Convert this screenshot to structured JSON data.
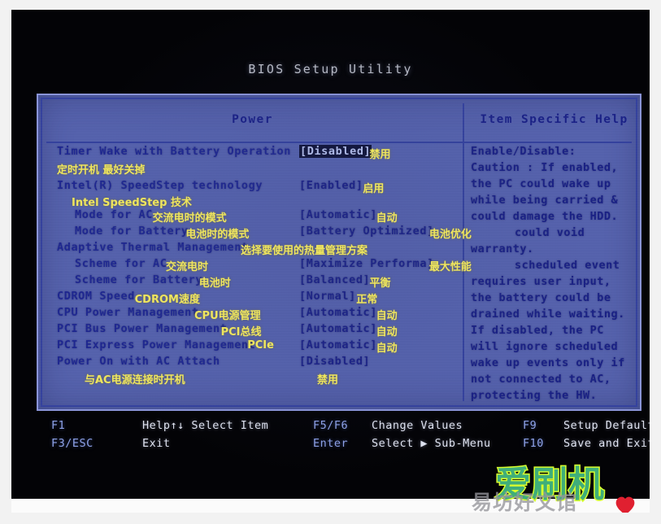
{
  "window": {
    "title": "BIOS Setup Utility"
  },
  "columns": {
    "left_title": "Power",
    "right_title": "Item Specific Help"
  },
  "settings": [
    {
      "label": "Timer Wake with Battery Operation",
      "label_cn": "定时开机   最好关掉",
      "value": "[Disabled]",
      "value_cn": "禁用",
      "selected": true,
      "indent": 0
    },
    {
      "label": "Intel(R) SpeedStep technology",
      "label_cn": "Intel SpeedStep 技术",
      "value": "[Enabled]",
      "value_cn": "启用",
      "selected": false,
      "indent": 0
    },
    {
      "label": "Mode for AC",
      "label_cn": "交流电时的模式",
      "value": "[Automatic]",
      "value_cn": "自动",
      "selected": false,
      "indent": 1
    },
    {
      "label": "Mode for Battery",
      "label_cn": "电池时的模式",
      "value": "[Battery Optimized]",
      "value_cn": "电池优化",
      "selected": false,
      "indent": 1
    },
    {
      "label": "Adaptive Thermal Management",
      "label_cn": "选择要使用的热量管理方案",
      "value": "",
      "value_cn": "",
      "selected": false,
      "indent": 0
    },
    {
      "label": "Scheme for AC",
      "label_cn": "交流电时",
      "value": "[Maximize Performa]",
      "value_cn": "最大性能",
      "selected": false,
      "indent": 1
    },
    {
      "label": "Scheme for Battery",
      "label_cn": "电池时",
      "value": "[Balanced]",
      "value_cn": "平衡",
      "selected": false,
      "indent": 1
    },
    {
      "label": "CDROM Speed",
      "label_cn": "CDROM速度",
      "value": "[Normal]",
      "value_cn": "正常",
      "selected": false,
      "indent": 0
    },
    {
      "label": "CPU Power Management",
      "label_cn": "CPU电源管理",
      "value": "[Automatic]",
      "value_cn": "自动",
      "selected": false,
      "indent": 0
    },
    {
      "label": "PCI Bus Power Management",
      "label_cn": "PCI总线",
      "value": "[Automatic]",
      "value_cn": "自动",
      "selected": false,
      "indent": 0
    },
    {
      "label": "PCI Express Power Management",
      "label_cn": "PCIe",
      "value": "[Automatic]",
      "value_cn": "自动",
      "selected": false,
      "indent": 0
    },
    {
      "label": "Power On with AC Attach",
      "label_cn": "与AC电源连接时开机",
      "value": "[Disabled]",
      "value_cn": "禁用",
      "selected": false,
      "indent": 0
    }
  ],
  "help": {
    "lines": [
      "Enable/Disable:",
      "Caution : If enabled,",
      "the PC could wake up",
      "while being carried &",
      "could damage the HDD.",
      "could void",
      "warranty.",
      "scheduled event",
      "requires user  input,",
      "the battery could be",
      "drained while waiting.",
      "If disabled, the PC",
      "will ignore scheduled",
      "wake up events only if",
      "not connected to AC,",
      "protecting the HW."
    ]
  },
  "legend": [
    {
      "key": "F1",
      "desc": "Help↑↓  Select Item"
    },
    {
      "key": "F3/ESC",
      "desc": "Exit"
    },
    {
      "key": "F5/F6",
      "desc": "Change Values"
    },
    {
      "key": "Enter",
      "desc": "Select ▶ Sub-Menu"
    },
    {
      "key": "F9",
      "desc": "Setup Defaults"
    },
    {
      "key": "F10",
      "desc": "Save and Exit"
    }
  ],
  "watermarks": {
    "main": "爱刷机",
    "sub": "易坊好文馆"
  }
}
